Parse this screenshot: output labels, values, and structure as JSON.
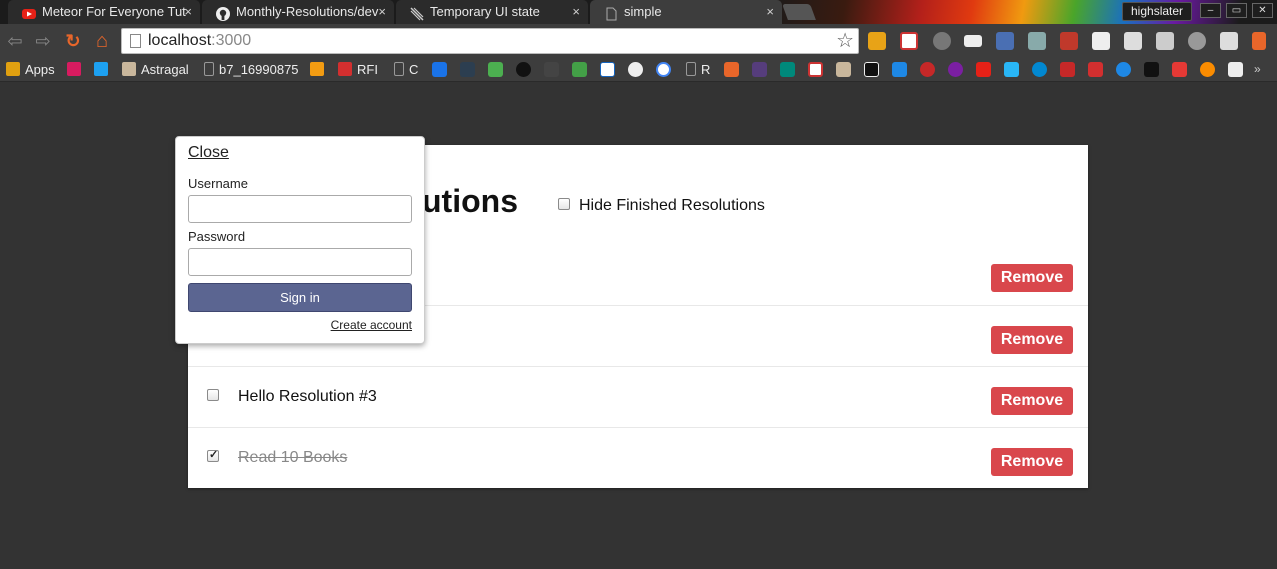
{
  "browser": {
    "tabs": [
      {
        "title": "Meteor For Everyone Tut",
        "active": false
      },
      {
        "title": "Monthly-Resolutions/dev",
        "active": false
      },
      {
        "title": "Temporary UI state",
        "active": false
      },
      {
        "title": "simple",
        "active": true
      }
    ],
    "tab_close": "×",
    "profile": "highslater",
    "window_controls": [
      "–",
      "▭",
      "✕"
    ],
    "url_host": "localhost",
    "url_port": ":3000",
    "star": "☆",
    "nav": {
      "back": "⇦",
      "forward": "⇨",
      "reload": "↻",
      "home": "⌂"
    }
  },
  "bookmarks": [
    {
      "label": "Apps",
      "color": "#e0a010"
    },
    {
      "label": "",
      "color": "#d81b60"
    },
    {
      "label": "",
      "color": "#1da1f2"
    },
    {
      "label": "Astragal",
      "color": "#c9b79c"
    },
    {
      "label": "b7_16990875",
      "color": "#777777"
    },
    {
      "label": "",
      "color": "#f39c12"
    },
    {
      "label": "RFI",
      "color": "#d32f2f"
    },
    {
      "label": "C",
      "color": "#777777"
    },
    {
      "label": "R",
      "color": "#777777"
    }
  ],
  "page": {
    "title": "utions",
    "hide_finished_label": "Hide Finished Resolutions",
    "resolutions": [
      {
        "text": "",
        "checked": false,
        "remove_label": "Remove"
      },
      {
        "text": "",
        "checked": false,
        "remove_label": "Remove"
      },
      {
        "text": "Hello Resolution #3",
        "checked": false,
        "remove_label": "Remove"
      },
      {
        "text": "Read 10 Books",
        "checked": true,
        "remove_label": "Remove"
      }
    ]
  },
  "login": {
    "close_label": "Close",
    "username_label": "Username",
    "username_value": "",
    "password_label": "Password",
    "password_value": "",
    "signin_label": "Sign in",
    "create_account_label": "Create account"
  },
  "colors": {
    "page_background": "#333333",
    "remove_button": "#d9474c",
    "signin_button": "#5b6591"
  }
}
